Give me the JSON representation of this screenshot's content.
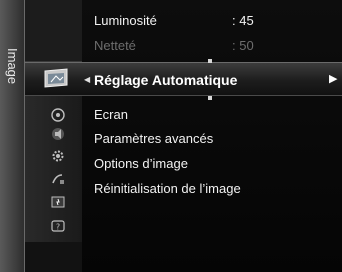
{
  "side_tab": {
    "label": "Image"
  },
  "top_items": [
    {
      "label": "Luminosité",
      "value": ": 45"
    },
    {
      "label": "Netteté",
      "value": ": 50"
    }
  ],
  "selected": {
    "label": "Réglage Automatique",
    "arrow_right": "▶",
    "arrow_left": "◀"
  },
  "menu_items": [
    {
      "label": "Ecran"
    },
    {
      "label": "Paramètres avancés"
    },
    {
      "label": "Options d’image"
    },
    {
      "label": "Réinitialisation de l’image"
    }
  ],
  "icons": [
    "picture-icon",
    "input-icon",
    "sound-icon",
    "setup-icon",
    "channel-icon",
    "application-icon",
    "help-icon"
  ]
}
